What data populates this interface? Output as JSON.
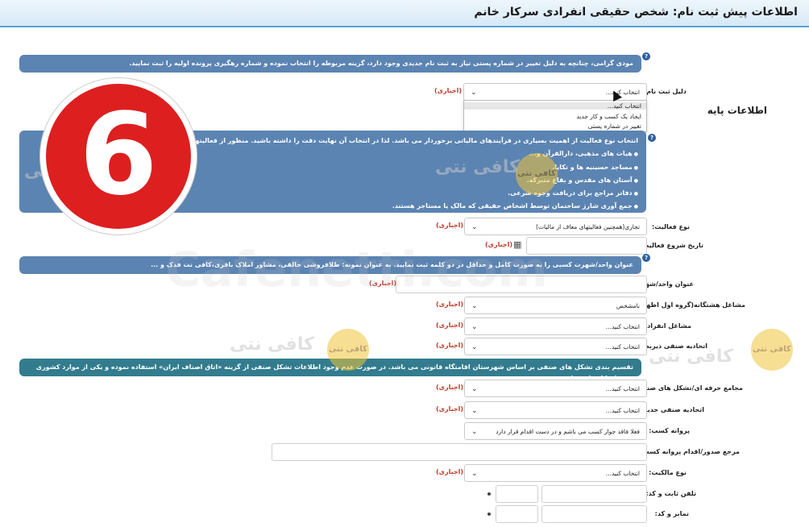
{
  "header": {
    "title": "اطلاعات پیش ثبت نام: شخص حقیقی انفرادی سرکار خانم"
  },
  "banner1": {
    "text": "مودی گرامی، چنانچه به دلیل تغییر در شماره پستی نیاز به ثبت نام جدیدی وجود دارد، گزینه مربوطه را انتخاب نموده و شماره رهگیری پرونده اولیه را ثبت نمایید."
  },
  "reason": {
    "label": "دلیل ثبت نام",
    "value": "انتخاب کنید...",
    "required": "(اجباری)",
    "options": [
      "انتخاب کنید...",
      "ایجاد یک کسب و کار جدید",
      "تغییر در شماره پستی"
    ]
  },
  "section_title": "اطلاعات پایه",
  "banner2": {
    "text": "انتخاب نوع فعالیت از اهمیت بسیاری در فرآیندهای مالیاتی برخوردار می باشد. لذا در انتخاب آن نهایت دقت را داشته باشید. منظور از فعالیتهای غیر تجاری، موارد ذیل",
    "bullets": [
      "هیات های مذهبی، دارالقرآن و...",
      "مساجد حسینیه ها و تکایا.",
      "آستان های مقدس و بقاع متبرکه.",
      "دفاتر مراجع برای دریافت وجوه شرعی.",
      "جمع آوری شارژ ساختمان توسط اشخاص حقیقی که مالک یا مستاجر هستند."
    ]
  },
  "activity_type": {
    "label": "نوع فعالیت:",
    "value": "تجاری(همچنین فعالیتهای معاف از مالیات)",
    "required": "(اجباری)"
  },
  "start_date": {
    "label": "تاریخ شروع فعالیت:",
    "required": "(اجباری)"
  },
  "banner3": {
    "text": "عنوان واحد/شهرت کسبی را به صورت کامل و حداقل در دو کلمه ثبت نمایید. به عنوان نمونه: طلافروشی خالقی، مشاور املاک باقری،کافی نت فدک و ..."
  },
  "business_name": {
    "label": "عنوان واحد/شهرت کسبی:",
    "required": "(اجباری)"
  },
  "isic_group": {
    "label": "مشاغل هشتگانه(گروه اول اظهارنامه):",
    "value": "نامشخص",
    "required": "(اجباری)"
  },
  "solo_job": {
    "label": "مشاغل انفرادی:",
    "value": "انتخاب کنید...",
    "required": "(اجباری)"
  },
  "guild_union": {
    "label": "اتحادیه صنفی ذیربط:",
    "value": "انتخاب کنید...",
    "required": "(اجباری)"
  },
  "banner4": {
    "text": "تقسیم بندی تشکل های صنفی بر اساس شهرستان اقامتگاه قانونی می باشد. در صورت عدم وجود اطلاعات تشکل صنفی از گزینه «اتاق اصناف ایران» استفاده نموده و یکی از موارد کشوری مرتبط را انتخاب نمایید."
  },
  "guild_assembly": {
    "label": "مجامع حرفه ای/تشکل های صنفی:",
    "value": "انتخاب کنید...",
    "required": "(اجباری)"
  },
  "new_union": {
    "label": "اتحادیه صنفی جدید:",
    "value": "انتخاب کنید...",
    "required": "(اجباری)"
  },
  "license": {
    "label": "پروانه کسب:",
    "value": "فعلا فاقد جواز کسب می باشم و در دست اقدام قرار دارد"
  },
  "license_authority": {
    "label": "مرجع صدور/اقدام پروانه کسب:"
  },
  "ownership": {
    "label": "نوع مالکیت:",
    "value": "انتخاب کنید...",
    "required": "(اجباری)"
  },
  "landline": {
    "label": "تلفن ثابت و کد:"
  },
  "fax": {
    "label": "نمابر و کد:"
  },
  "overlay": {
    "step_number": "6",
    "watermark_fa": "کافی نتی",
    "watermark_en": "Cafenetti.com",
    "logo": "کافی نتی"
  },
  "colors": {
    "banner": "#5b84b2",
    "banner_teal": "#327c8e",
    "required": "#c0392b",
    "badge": "#dd1f1f",
    "header_border": "#5a9fd4"
  },
  "icons": {
    "help": "question-circle-icon",
    "chevron": "chevron-down-icon",
    "calendar": "calendar-icon"
  }
}
